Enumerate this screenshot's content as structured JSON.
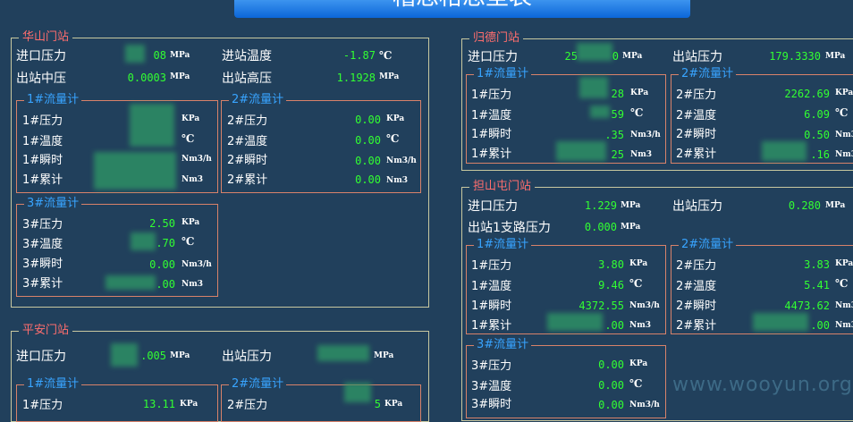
{
  "header": {
    "title": "稽思格思坚表"
  },
  "units": {
    "mpa": "MPa",
    "kpa": "KPa",
    "celsius": "℃",
    "flow": "Nm3/h",
    "total": "Nm3"
  },
  "huashan": {
    "name": "华山门站",
    "inlet_label": "进口压力",
    "inlet_value": "08",
    "temp_label": "进站温度",
    "temp_value": "-1.87",
    "mid_label": "出站中压",
    "mid_value": "0.0003",
    "high_label": "出站高压",
    "high_value": "1.1928",
    "m1": {
      "title": "1#流量计",
      "p_label": "1#压力",
      "t_label": "1#温度",
      "f_label": "1#瞬时",
      "c_label": "1#累计"
    },
    "m2": {
      "title": "2#流量计",
      "p_label": "2#压力",
      "p_value": "0.00",
      "t_label": "2#温度",
      "t_value": "0.00",
      "f_label": "2#瞬时",
      "f_value": "0.00",
      "c_label": "2#累计",
      "c_value": "0.00"
    },
    "m3": {
      "title": "3#流量计",
      "p_label": "3#压力",
      "p_value": "2.50",
      "t_label": "3#温度",
      "t_value": ".70",
      "f_label": "3#瞬时",
      "f_value": "0.00",
      "c_label": "3#累计",
      "c_value": ".00"
    }
  },
  "guide": {
    "name": "归德门站",
    "inlet_label": "进口压力",
    "inlet_value": "25",
    "outlet_label": "出站压力",
    "outlet_value": "179.3330",
    "m1": {
      "title": "1#流量计",
      "p_label": "1#压力",
      "p_value": "28",
      "t_label": "1#温度",
      "t_value": "59",
      "f_label": "1#瞬时",
      "f_value": ".35",
      "c_label": "1#累计",
      "c_value": "25"
    },
    "m2": {
      "title": "2#流量计",
      "p_label": "2#压力",
      "p_value": "2262.69",
      "t_label": "2#温度",
      "t_value": "6.09",
      "f_label": "2#瞬时",
      "f_value": "0.50",
      "c_label": "2#累计",
      "c_value": ".16"
    }
  },
  "danshantun": {
    "name": "担山屯门站",
    "inlet_label": "进口压力",
    "inlet_value": "1.229",
    "outlet_label": "出站压力",
    "outlet_value": "0.280",
    "branch_label": "出站1支路压力",
    "branch_value": "0.000",
    "m1": {
      "title": "1#流量计",
      "p_label": "1#压力",
      "p_value": "3.80",
      "t_label": "1#温度",
      "t_value": "9.46",
      "f_label": "1#瞬时",
      "f_value": "4372.55",
      "c_label": "1#累计",
      "c_value": ".00"
    },
    "m2": {
      "title": "2#流量计",
      "p_label": "2#压力",
      "p_value": "3.83",
      "t_label": "2#温度",
      "t_value": "5.41",
      "f_label": "2#瞬时",
      "f_value": "4473.62",
      "c_label": "2#累计",
      "c_value": ".00"
    },
    "m3": {
      "title": "3#流量计",
      "p_label": "3#压力",
      "p_value": "0.00",
      "t_label": "3#温度",
      "t_value": "0.00",
      "f_label": "3#瞬时",
      "f_value": "0.00"
    }
  },
  "pingan": {
    "name": "平安门站",
    "inlet_label": "进口压力",
    "inlet_value": ".005",
    "outlet_label": "出站压力",
    "m1": {
      "title": "1#流量计",
      "p_label": "1#压力",
      "p_value": "13.11"
    },
    "m2": {
      "title": "2#流量计",
      "p_label": "2#压力",
      "p_value": "5"
    }
  },
  "watermark": "www.wooyun.org"
}
